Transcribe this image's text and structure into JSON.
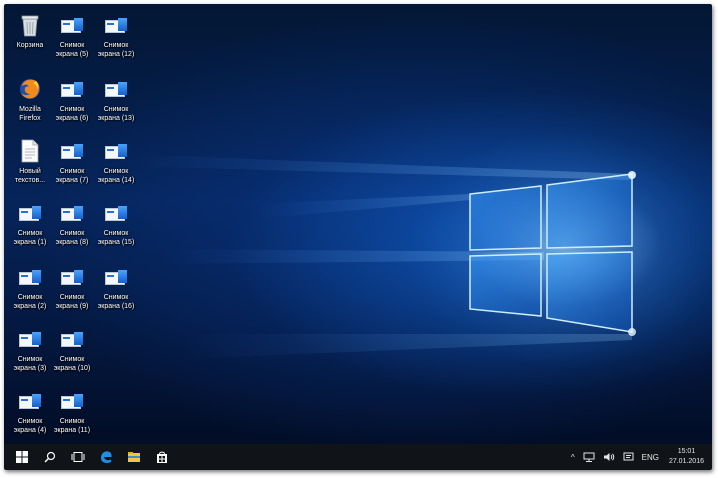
{
  "desktop": {
    "icons": [
      {
        "name": "recycle-bin-icon",
        "label": "Корзина",
        "type": "bin"
      },
      {
        "name": "firefox-icon",
        "label": "Mozilla\nFirefox",
        "type": "firefox"
      },
      {
        "name": "text-file-icon",
        "label": "Новый\nтекстов...",
        "type": "doc"
      },
      {
        "name": "screenshot-icon",
        "label": "Снимок\nэкрана (1)",
        "type": "shot"
      },
      {
        "name": "screenshot-icon",
        "label": "Снимок\nэкрана (2)",
        "type": "shot"
      },
      {
        "name": "screenshot-icon",
        "label": "Снимок\nэкрана (3)",
        "type": "shot"
      },
      {
        "name": "screenshot-icon",
        "label": "Снимок\nэкрана (4)",
        "type": "shot"
      },
      {
        "name": "screenshot-icon",
        "label": "Снимок\nэкрана (5)",
        "type": "shot"
      },
      {
        "name": "screenshot-icon",
        "label": "Снимок\nэкрана (6)",
        "type": "shot"
      },
      {
        "name": "screenshot-icon",
        "label": "Снимок\nэкрана (7)",
        "type": "shot"
      },
      {
        "name": "screenshot-icon",
        "label": "Снимок\nэкрана (8)",
        "type": "shot"
      },
      {
        "name": "screenshot-icon",
        "label": "Снимок\nэкрана (9)",
        "type": "shot"
      },
      {
        "name": "screenshot-icon",
        "label": "Снимок\nэкрана (10)",
        "type": "shot"
      },
      {
        "name": "screenshot-icon",
        "label": "Снимок\nэкрана (11)",
        "type": "shot"
      },
      {
        "name": "screenshot-icon",
        "label": "Снимок\nэкрана (12)",
        "type": "shot"
      },
      {
        "name": "screenshot-icon",
        "label": "Снимок\nэкрана (13)",
        "type": "shot"
      },
      {
        "name": "screenshot-icon",
        "label": "Снимок\nэкрана (14)",
        "type": "shot"
      },
      {
        "name": "screenshot-icon",
        "label": "Снимок\nэкрана (15)",
        "type": "shot"
      },
      {
        "name": "screenshot-icon",
        "label": "Снимок\nэкрана (16)",
        "type": "shot"
      }
    ]
  },
  "taskbar": {
    "buttons": [
      {
        "name": "start-button",
        "icon": "windows-logo-icon"
      },
      {
        "name": "search-button",
        "icon": "search-icon"
      },
      {
        "name": "task-view-button",
        "icon": "task-view-icon"
      },
      {
        "name": "edge-button",
        "icon": "edge-icon"
      },
      {
        "name": "file-explorer-button",
        "icon": "folder-icon"
      },
      {
        "name": "store-button",
        "icon": "store-icon"
      }
    ],
    "tray": {
      "chevron": "^",
      "language": "ENG",
      "time": "15:01",
      "date": "27.01.2016",
      "icons": [
        "network-icon",
        "volume-icon",
        "action-center-icon"
      ]
    },
    "background": "#101318",
    "accent": "#1e8fe6"
  }
}
